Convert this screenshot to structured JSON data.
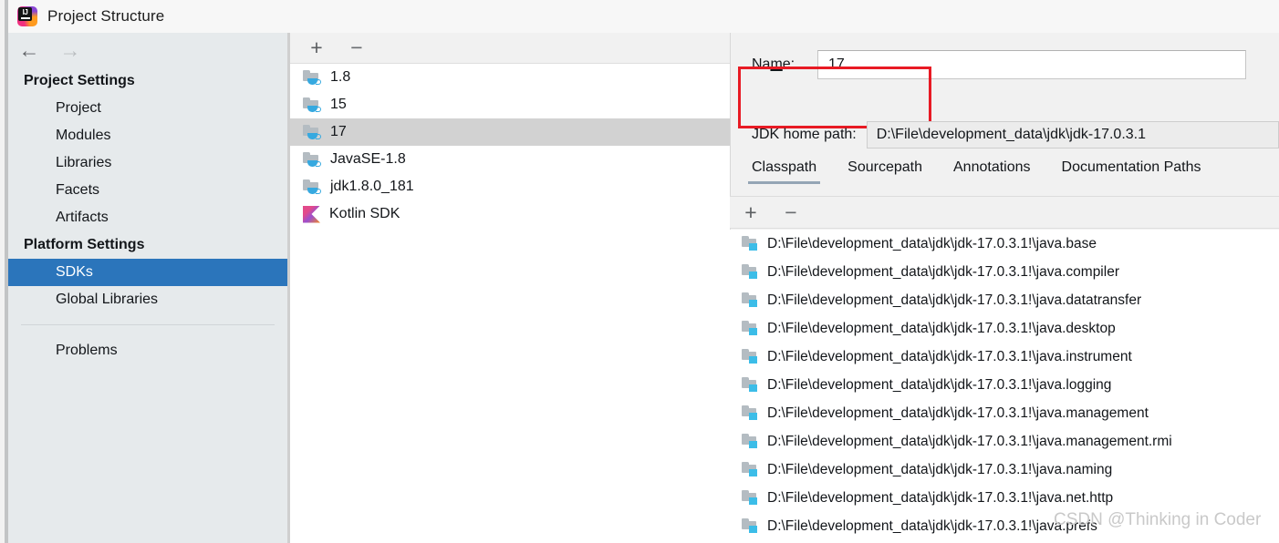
{
  "window": {
    "title": "Project Structure",
    "icon": "intellij-idea-icon"
  },
  "sidebar": {
    "nav": {
      "back_icon": "arrow-left-icon",
      "back_glyph": "←",
      "forward_icon": "arrow-right-icon",
      "forward_glyph": "→"
    },
    "groups": [
      {
        "label": "Project Settings",
        "items": [
          {
            "label": "Project",
            "selected": false
          },
          {
            "label": "Modules",
            "selected": false
          },
          {
            "label": "Libraries",
            "selected": false
          },
          {
            "label": "Facets",
            "selected": false
          },
          {
            "label": "Artifacts",
            "selected": false
          }
        ]
      },
      {
        "label": "Platform Settings",
        "items": [
          {
            "label": "SDKs",
            "selected": true
          },
          {
            "label": "Global Libraries",
            "selected": false
          }
        ]
      }
    ],
    "problems_label": "Problems",
    "selected_color": "#2b75bb",
    "background_color": "#e6eaec"
  },
  "sdk_panel": {
    "toolbar": {
      "add_label": "+",
      "remove_label": "−"
    },
    "items": [
      {
        "label": "1.8",
        "icon": "jdk-icon",
        "selected": false
      },
      {
        "label": "15",
        "icon": "jdk-icon",
        "selected": false
      },
      {
        "label": "17",
        "icon": "jdk-icon",
        "selected": true
      },
      {
        "label": "JavaSE-1.8",
        "icon": "jdk-icon",
        "selected": false
      },
      {
        "label": "jdk1.8.0_181",
        "icon": "jdk-icon",
        "selected": false
      },
      {
        "label": "Kotlin SDK",
        "icon": "kotlin-icon",
        "selected": false
      }
    ],
    "selected_row_color": "#d2d2d2"
  },
  "detail": {
    "name_label": "Name:",
    "name_mnemonic": "m",
    "name_value": "17",
    "highlight_color": "#e81a24",
    "home_path_label": "JDK home path:",
    "home_path_value": "D:\\File\\development_data\\jdk\\jdk-17.0.3.1",
    "tabs": [
      {
        "label": "Classpath",
        "active": true
      },
      {
        "label": "Sourcepath",
        "active": false
      },
      {
        "label": "Annotations",
        "active": false
      },
      {
        "label": "Documentation Paths",
        "active": false
      }
    ],
    "classpath_toolbar": {
      "add_label": "+",
      "remove_label": "−"
    },
    "classpath_items": [
      "D:\\File\\development_data\\jdk\\jdk-17.0.3.1!\\java.base",
      "D:\\File\\development_data\\jdk\\jdk-17.0.3.1!\\java.compiler",
      "D:\\File\\development_data\\jdk\\jdk-17.0.3.1!\\java.datatransfer",
      "D:\\File\\development_data\\jdk\\jdk-17.0.3.1!\\java.desktop",
      "D:\\File\\development_data\\jdk\\jdk-17.0.3.1!\\java.instrument",
      "D:\\File\\development_data\\jdk\\jdk-17.0.3.1!\\java.logging",
      "D:\\File\\development_data\\jdk\\jdk-17.0.3.1!\\java.management",
      "D:\\File\\development_data\\jdk\\jdk-17.0.3.1!\\java.management.rmi",
      "D:\\File\\development_data\\jdk\\jdk-17.0.3.1!\\java.naming",
      "D:\\File\\development_data\\jdk\\jdk-17.0.3.1!\\java.net.http",
      "D:\\File\\development_data\\jdk\\jdk-17.0.3.1!\\java.prefs"
    ]
  },
  "watermark": {
    "text": "CSDN @Thinking in Coder"
  }
}
